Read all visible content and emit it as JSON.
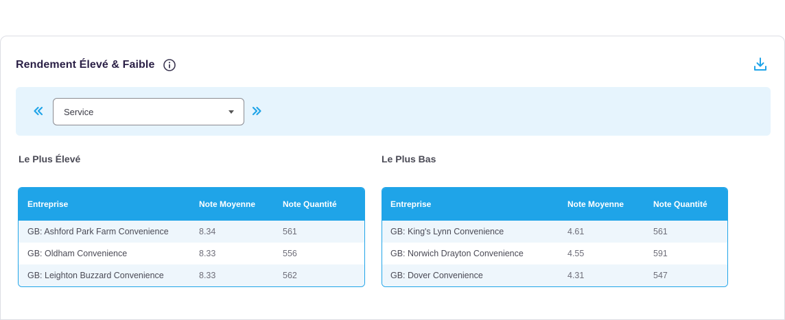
{
  "card": {
    "title": "Rendement Élevé & Faible"
  },
  "filter": {
    "selected": "Service"
  },
  "highest": {
    "title": "Le Plus Élevé",
    "columns": [
      "Entreprise",
      "Note Moyenne",
      "Note Quantité"
    ],
    "rows": [
      [
        "GB: Ashford Park Farm Convenience",
        "8.34",
        "561"
      ],
      [
        "GB: Oldham Convenience",
        "8.33",
        "556"
      ],
      [
        "GB: Leighton Buzzard Convenience",
        "8.33",
        "562"
      ]
    ]
  },
  "lowest": {
    "title": "Le Plus Bas",
    "columns": [
      "Entreprise",
      "Note Moyenne",
      "Note Quantité"
    ],
    "rows": [
      [
        "GB: King's Lynn Convenience",
        "4.61",
        "561"
      ],
      [
        "GB: Norwich Drayton Convenience",
        "4.55",
        "591"
      ],
      [
        "GB: Dover Convenience",
        "4.31",
        "547"
      ]
    ]
  },
  "colors": {
    "accent": "#1fa4e8",
    "filter_bg": "#e6f4fd",
    "title": "#2a1f45"
  },
  "icons": {
    "info": "info-icon",
    "download": "download-icon",
    "prev": "double-chevron-left-icon",
    "next": "double-chevron-right-icon"
  }
}
